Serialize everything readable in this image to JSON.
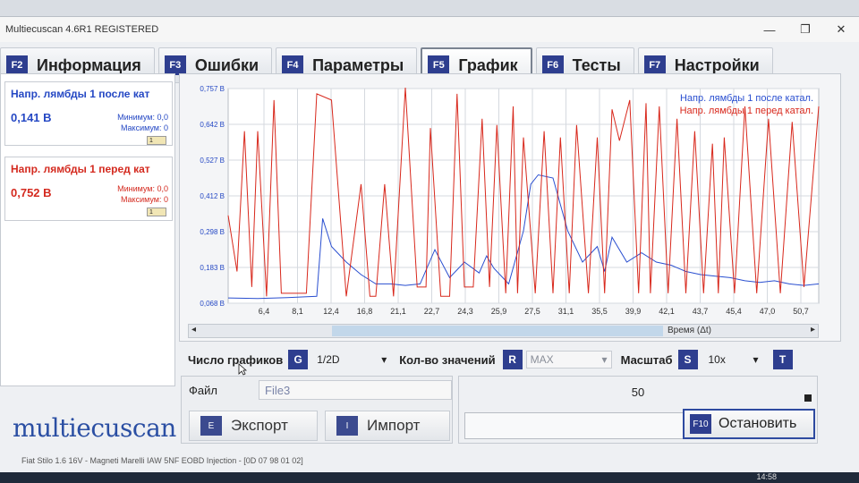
{
  "window": {
    "title": "Multiecuscan 4.6R1 REGISTERED",
    "minimize": "—",
    "restore": "❐",
    "close": "✕"
  },
  "tabs": [
    {
      "key": "F2",
      "label": "Информация",
      "active": false
    },
    {
      "key": "F3",
      "label": "Ошибки",
      "active": false
    },
    {
      "key": "F4",
      "label": "Параметры",
      "active": false
    },
    {
      "key": "F5",
      "label": "График",
      "active": true
    },
    {
      "key": "F6",
      "label": "Тесты",
      "active": false
    },
    {
      "key": "F7",
      "label": "Настройки",
      "active": false
    }
  ],
  "sensors": [
    {
      "name": "Напр. лямбды 1 после кат",
      "value": "0,141 В",
      "min_label": "Минимум: 0,0",
      "max_label": "Максимум: 0",
      "mini": "1",
      "color": "#2548c4"
    },
    {
      "name": "Напр. лямбды 1 перед кат",
      "value": "0,752 В",
      "min_label": "Минимум: 0,0",
      "max_label": "Максимум: 0",
      "mini": "1",
      "color": "#d42a1f"
    }
  ],
  "chart_data": {
    "type": "line",
    "yticks": [
      "0,757 В",
      "0,642 В",
      "0,527 В",
      "0,412 В",
      "0,298 В",
      "0,183 В",
      "0,068 В"
    ],
    "ylim": [
      0.068,
      0.757
    ],
    "xticks": [
      "6,4",
      "8,1",
      "12,4",
      "16,8",
      "21,1",
      "22,7",
      "24,3",
      "25,9",
      "27,5",
      "31,1",
      "35,5",
      "39,9",
      "42,1",
      "43,7",
      "45,4",
      "47,0",
      "50,7"
    ],
    "xlim": [
      0,
      40
    ],
    "grid": true,
    "legend": "top-right",
    "series": [
      {
        "name": "Напр. лямбды 1 после катал.",
        "color": "#2a4fd0",
        "x": [
          0,
          2,
          4,
          5,
          6,
          6.4,
          7,
          8,
          9,
          10,
          11,
          12,
          13,
          14,
          15,
          16,
          17,
          17.5,
          18,
          19,
          20,
          20.5,
          21,
          22,
          23,
          24,
          25,
          25.5,
          26,
          27,
          28,
          29,
          30,
          31,
          32,
          33,
          34,
          35,
          36,
          37,
          38,
          39,
          40
        ],
        "y": [
          0.085,
          0.083,
          0.086,
          0.088,
          0.09,
          0.34,
          0.25,
          0.2,
          0.16,
          0.13,
          0.13,
          0.125,
          0.13,
          0.24,
          0.15,
          0.2,
          0.165,
          0.22,
          0.18,
          0.13,
          0.3,
          0.45,
          0.48,
          0.47,
          0.3,
          0.2,
          0.25,
          0.17,
          0.28,
          0.2,
          0.23,
          0.2,
          0.19,
          0.17,
          0.16,
          0.155,
          0.15,
          0.14,
          0.135,
          0.14,
          0.13,
          0.125,
          0.13
        ]
      },
      {
        "name": "Напр. лямбды 1 перед катал.",
        "color": "#d8281c",
        "x": [
          0,
          0.6,
          1.1,
          1.6,
          2,
          2.6,
          3.1,
          3.6,
          4.4,
          5.3,
          6,
          7,
          8,
          9,
          9.6,
          10,
          10.6,
          11.2,
          12,
          12.8,
          13.4,
          13.7,
          14.4,
          15,
          15.5,
          16,
          16.6,
          17.2,
          17.7,
          18.2,
          18.8,
          19.3,
          19.6,
          20,
          20.8,
          21.4,
          22,
          22.5,
          23.1,
          23.6,
          24.4,
          25,
          25.5,
          26,
          26.5,
          27.2,
          27.8,
          28.3,
          28.6,
          29.2,
          29.8,
          30.4,
          31,
          31.6,
          32.2,
          32.8,
          33.2,
          33.6,
          34.3,
          35,
          35.8,
          36.6,
          37.4,
          38.2,
          39,
          40
        ],
        "y": [
          0.35,
          0.17,
          0.62,
          0.12,
          0.62,
          0.09,
          0.72,
          0.1,
          0.1,
          0.1,
          0.74,
          0.72,
          0.09,
          0.45,
          0.09,
          0.09,
          0.45,
          0.09,
          0.76,
          0.12,
          0.12,
          0.63,
          0.09,
          0.09,
          0.74,
          0.12,
          0.12,
          0.66,
          0.12,
          0.64,
          0.1,
          0.7,
          0.1,
          0.6,
          0.1,
          0.62,
          0.1,
          0.6,
          0.1,
          0.64,
          0.1,
          0.6,
          0.1,
          0.69,
          0.59,
          0.72,
          0.1,
          0.71,
          0.1,
          0.7,
          0.1,
          0.66,
          0.1,
          0.62,
          0.1,
          0.58,
          0.1,
          0.6,
          0.1,
          0.7,
          0.1,
          0.66,
          0.1,
          0.65,
          0.12,
          0.7
        ]
      }
    ]
  },
  "scrollbar": {
    "label": "Время (Δt)",
    "left_arrow": "◂",
    "right_arrow": "▸"
  },
  "controls": {
    "graphs_label": "Число графиков",
    "graphs_key": "G",
    "graphs_value": "1/2D",
    "count_label": "Кол-во значений",
    "count_key": "R",
    "count_value": "MAX",
    "scale_label": "Масштаб",
    "scale_key": "S",
    "scale_value": "10x",
    "extra_key": "T",
    "dropdown_arrow": "▾"
  },
  "file": {
    "label": "Файл",
    "value": "File3",
    "export_key": "E",
    "export_label": "Экспорт",
    "import_key": "I",
    "import_label": "Импорт"
  },
  "record": {
    "count": "50",
    "stop_key": "F10",
    "stop_label": "Остановить"
  },
  "brand": "multiecuscan",
  "status": "Fiat Stilo 1.6 16V - Magneti Marelli IAW 5NF EOBD Injection - [0D 07 98 01 02]",
  "clock": "14:58"
}
